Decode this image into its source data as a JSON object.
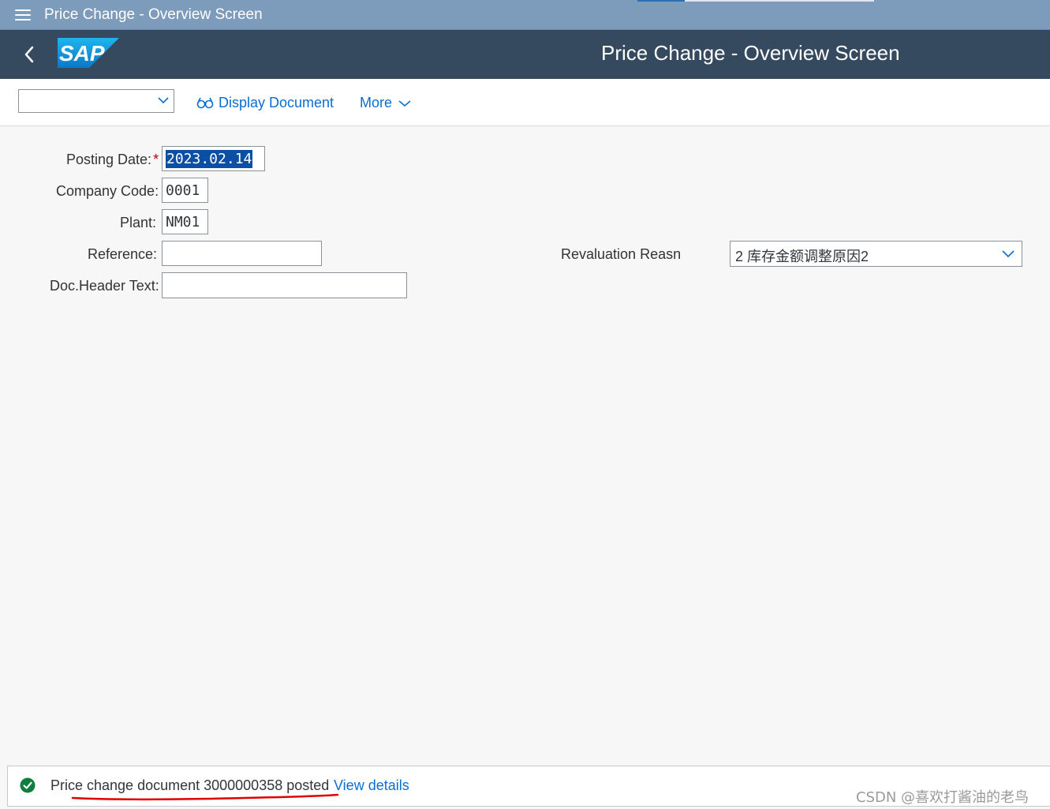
{
  "window": {
    "title": "Price Change - Overview Screen"
  },
  "shell": {
    "logo_text": "SAP",
    "app_title": "Price Change - Overview Screen"
  },
  "toolbar": {
    "variant_value": "",
    "display_document_label": "Display Document",
    "more_label": "More"
  },
  "form": {
    "posting_date": {
      "label": "Posting Date:",
      "required_mark": "*",
      "value": "2023.02.14"
    },
    "company_code": {
      "label": "Company Code:",
      "value": "0001"
    },
    "plant": {
      "label": "Plant:",
      "value": "NM01"
    },
    "reference": {
      "label": "Reference:",
      "value": ""
    },
    "doc_header_text": {
      "label": "Doc.Header Text:",
      "value": ""
    },
    "revaluation_reason": {
      "label": "Revaluation Reasn",
      "value": "2 库存金额调整原因2"
    }
  },
  "message": {
    "status": "success",
    "text": "Price change document 3000000358 posted",
    "link_label": "View details"
  },
  "watermark": "CSDN @喜欢打酱油的老鸟",
  "colors": {
    "title_bar": "#7d9bbb",
    "shell_bar": "#354a5f",
    "link": "#0a6ed1",
    "success": "#107e3e",
    "annotation": "#e00000",
    "required": "#bb0000"
  },
  "icons": {
    "menu": "hamburger-icon",
    "back": "chevron-left-icon",
    "display": "glasses-icon",
    "dropdown": "chevron-down-icon",
    "status": "success-check-icon"
  }
}
